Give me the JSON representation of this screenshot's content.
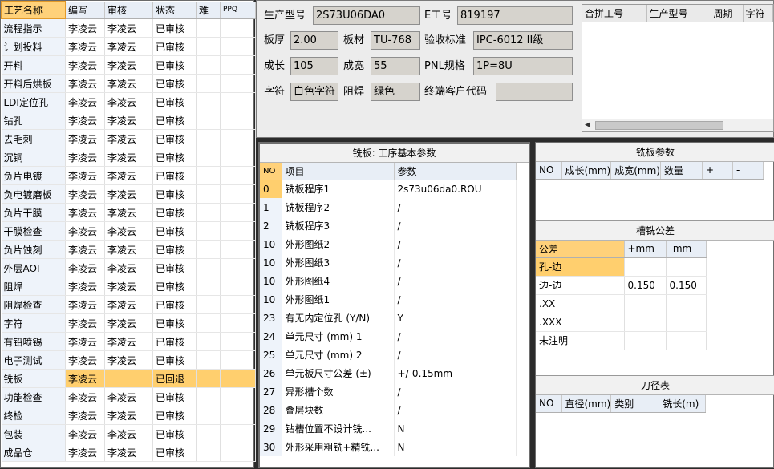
{
  "process_list": {
    "headers": [
      "工艺名称",
      "编写",
      "审核",
      "状态",
      "难",
      "PPQ"
    ],
    "rows": [
      [
        "流程指示",
        "李凌云",
        "李凌云",
        "已审核"
      ],
      [
        "计划投料",
        "李凌云",
        "李凌云",
        "已审核"
      ],
      [
        "开料",
        "李凌云",
        "李凌云",
        "已审核"
      ],
      [
        "开料后烘板",
        "李凌云",
        "李凌云",
        "已审核"
      ],
      [
        "LDI定位孔",
        "李凌云",
        "李凌云",
        "已审核"
      ],
      [
        "钻孔",
        "李凌云",
        "李凌云",
        "已审核"
      ],
      [
        "去毛刺",
        "李凌云",
        "李凌云",
        "已审核"
      ],
      [
        "沉铜",
        "李凌云",
        "李凌云",
        "已审核"
      ],
      [
        "负片电镀",
        "李凌云",
        "李凌云",
        "已审核"
      ],
      [
        "负电镀磨板",
        "李凌云",
        "李凌云",
        "已审核"
      ],
      [
        "负片干膜",
        "李凌云",
        "李凌云",
        "已审核"
      ],
      [
        "干膜检查",
        "李凌云",
        "李凌云",
        "已审核"
      ],
      [
        "负片蚀刻",
        "李凌云",
        "李凌云",
        "已审核"
      ],
      [
        "外层AOI",
        "李凌云",
        "李凌云",
        "已审核"
      ],
      [
        "阻焊",
        "李凌云",
        "李凌云",
        "已审核"
      ],
      [
        "阻焊检查",
        "李凌云",
        "李凌云",
        "已审核"
      ],
      [
        "字符",
        "李凌云",
        "李凌云",
        "已审核"
      ],
      [
        "有铅喷锡",
        "李凌云",
        "李凌云",
        "已审核"
      ],
      [
        "电子测试",
        "李凌云",
        "李凌云",
        "已审核"
      ],
      [
        "铣板",
        "李凌云",
        "",
        "已回退"
      ],
      [
        "功能检查",
        "李凌云",
        "李凌云",
        "已审核"
      ],
      [
        "终检",
        "李凌云",
        "李凌云",
        "已审核"
      ],
      [
        "包装",
        "李凌云",
        "李凌云",
        "已审核"
      ],
      [
        "成品仓",
        "李凌云",
        "李凌云",
        "已审核"
      ]
    ]
  },
  "info": {
    "model_label": "生产型号",
    "model_value": "2S73U06DA0",
    "eno_label": "E工号",
    "eno_value": "819197",
    "thick_label": "板厚",
    "thick_value": "2.00",
    "material_label": "板材",
    "material_value": "TU-768",
    "std_label": "验收标准",
    "std_value": "IPC-6012 II级",
    "len_label": "成长",
    "len_value": "105",
    "wid_label": "成宽",
    "wid_value": "55",
    "pnl_label": "PNL规格",
    "pnl_value": "1P=8U",
    "char_label": "字符",
    "char_value": "白色字符",
    "mask_label": "阻焊",
    "mask_value": "绿色",
    "cust_label": "终端客户代码",
    "cust_value": ""
  },
  "merge_grid": {
    "headers": [
      "合拼工号",
      "生产型号",
      "周期",
      "字符"
    ]
  },
  "params": {
    "title": "铣板: 工序基本参数",
    "headers": [
      "NO",
      "项目",
      "参数"
    ],
    "rows": [
      [
        "0",
        "铣板程序1",
        "2s73u06da0.ROU"
      ],
      [
        "1",
        "铣板程序2",
        "/"
      ],
      [
        "2",
        "铣板程序3",
        "/"
      ],
      [
        "10",
        "外形图纸2",
        "/"
      ],
      [
        "10",
        "外形图纸3",
        "/"
      ],
      [
        "10",
        "外形图纸4",
        "/"
      ],
      [
        "10",
        "外形图纸1",
        "/"
      ],
      [
        "23",
        "有无内定位孔 (Y/N)",
        "Y"
      ],
      [
        "24",
        "单元尺寸 (mm) 1",
        "/"
      ],
      [
        "25",
        "单元尺寸 (mm) 2",
        "/"
      ],
      [
        "26",
        "单元板尺寸公差 (±)",
        "+/-0.15mm"
      ],
      [
        "27",
        "异形槽个数",
        "/"
      ],
      [
        "28",
        "叠层块数",
        "/"
      ],
      [
        "29",
        "钻槽位置不设计铣...",
        "N"
      ],
      [
        "30",
        "外形采用粗铣+精铣...",
        "N"
      ]
    ]
  },
  "mill_params": {
    "title": "铣板参数",
    "headers": [
      "NO",
      "成长(mm)",
      "成宽(mm)",
      "数量",
      "+",
      "-"
    ]
  },
  "slot_tol": {
    "title": "槽铣公差",
    "headers": [
      "公差",
      "+mm",
      "-mm"
    ],
    "rows": [
      [
        "孔-边",
        "",
        ""
      ],
      [
        "边-边",
        "0.150",
        "0.150"
      ],
      [
        ".XX",
        "",
        ""
      ],
      [
        ".XXX",
        "",
        ""
      ],
      [
        "未注明",
        "",
        ""
      ]
    ]
  },
  "tools": {
    "title": "刀径表",
    "headers": [
      "NO",
      "直径(mm)",
      "类别",
      "铣长(m)"
    ]
  }
}
